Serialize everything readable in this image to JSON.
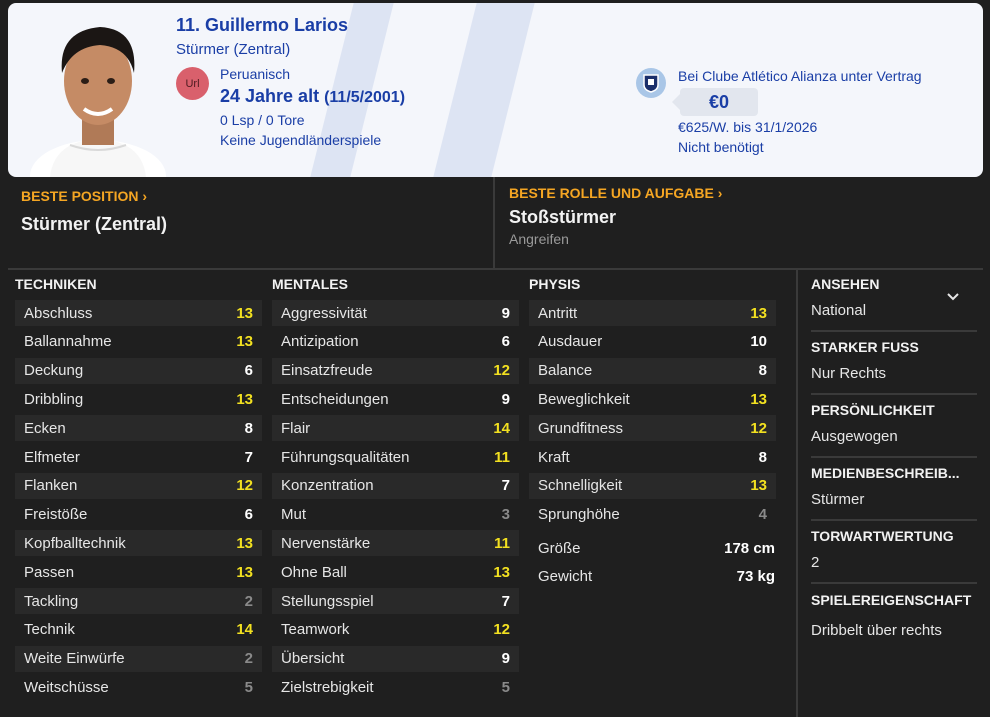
{
  "header": {
    "name": "11. Guillermo Larios",
    "position": "Stürmer (Zentral)",
    "nationality_badge": "Url",
    "nationality": "Peruanisch",
    "age": "24 Jahre alt",
    "dob": "(11/5/2001)",
    "caps": "0 Lsp / 0 Tore",
    "youth": "Keine Jugendländerspiele",
    "club_contract": "Bei Clube Atlético Alianza unter Vertrag",
    "value": "€0",
    "wage": "€625/W. bis 31/1/2026",
    "release": "Nicht benötigt"
  },
  "best_position": {
    "title": "BESTE POSITION",
    "value": "Stürmer (Zentral)"
  },
  "best_role": {
    "title": "BESTE ROLLE UND AUFGABE",
    "value": "Stoßstürmer",
    "duty": "Angreifen"
  },
  "columns": {
    "technical": {
      "title": "TECHNIKEN",
      "attrs": [
        {
          "label": "Abschluss",
          "value": "13",
          "tier": "y"
        },
        {
          "label": "Ballannahme",
          "value": "13",
          "tier": "y"
        },
        {
          "label": "Deckung",
          "value": "6",
          "tier": "w"
        },
        {
          "label": "Dribbling",
          "value": "13",
          "tier": "y"
        },
        {
          "label": "Ecken",
          "value": "8",
          "tier": "w"
        },
        {
          "label": "Elfmeter",
          "value": "7",
          "tier": "w"
        },
        {
          "label": "Flanken",
          "value": "12",
          "tier": "y"
        },
        {
          "label": "Freistöße",
          "value": "6",
          "tier": "w"
        },
        {
          "label": "Kopfballtechnik",
          "value": "13",
          "tier": "y"
        },
        {
          "label": "Passen",
          "value": "13",
          "tier": "y"
        },
        {
          "label": "Tackling",
          "value": "2",
          "tier": "g"
        },
        {
          "label": "Technik",
          "value": "14",
          "tier": "y"
        },
        {
          "label": "Weite Einwürfe",
          "value": "2",
          "tier": "g"
        },
        {
          "label": "Weitschüsse",
          "value": "5",
          "tier": "g"
        }
      ]
    },
    "mental": {
      "title": "MENTALES",
      "attrs": [
        {
          "label": "Aggressivität",
          "value": "9",
          "tier": "w"
        },
        {
          "label": "Antizipation",
          "value": "6",
          "tier": "w"
        },
        {
          "label": "Einsatzfreude",
          "value": "12",
          "tier": "y"
        },
        {
          "label": "Entscheidungen",
          "value": "9",
          "tier": "w"
        },
        {
          "label": "Flair",
          "value": "14",
          "tier": "y"
        },
        {
          "label": "Führungsqualitäten",
          "value": "11",
          "tier": "y"
        },
        {
          "label": "Konzentration",
          "value": "7",
          "tier": "w"
        },
        {
          "label": "Mut",
          "value": "3",
          "tier": "g"
        },
        {
          "label": "Nervenstärke",
          "value": "11",
          "tier": "y"
        },
        {
          "label": "Ohne Ball",
          "value": "13",
          "tier": "y"
        },
        {
          "label": "Stellungsspiel",
          "value": "7",
          "tier": "w"
        },
        {
          "label": "Teamwork",
          "value": "12",
          "tier": "y"
        },
        {
          "label": "Übersicht",
          "value": "9",
          "tier": "w"
        },
        {
          "label": "Zielstrebigkeit",
          "value": "5",
          "tier": "g"
        }
      ]
    },
    "physical": {
      "title": "PHYSIS",
      "attrs": [
        {
          "label": "Antritt",
          "value": "13",
          "tier": "y"
        },
        {
          "label": "Ausdauer",
          "value": "10",
          "tier": "w"
        },
        {
          "label": "Balance",
          "value": "8",
          "tier": "w"
        },
        {
          "label": "Beweglichkeit",
          "value": "13",
          "tier": "y"
        },
        {
          "label": "Grundfitness",
          "value": "12",
          "tier": "y"
        },
        {
          "label": "Kraft",
          "value": "8",
          "tier": "w"
        },
        {
          "label": "Schnelligkeit",
          "value": "13",
          "tier": "y"
        },
        {
          "label": "Sprunghöhe",
          "value": "4",
          "tier": "g"
        }
      ],
      "height_label": "Größe",
      "height_value": "178 cm",
      "weight_label": "Gewicht",
      "weight_value": "73 kg"
    }
  },
  "side": {
    "reputation_title": "ANSEHEN",
    "reputation": "National",
    "foot_title": "STARKER FUSS",
    "foot": "Nur Rechts",
    "personality_title": "PERSÖNLICHKEIT",
    "personality": "Ausgewogen",
    "media_title": "MEDIENBESCHREIB...",
    "media": "Stürmer",
    "gk_title": "TORWARTWERTUNG",
    "gk": "2",
    "traits_title": "SPIELEREIGENSCHAFT",
    "traits": "Dribbelt über rechts"
  },
  "colors": {
    "accent": "#f5a623",
    "high": "#f2e020",
    "header_text": "#1a3ea6"
  },
  "icons": {
    "reputation_toggle": "chevron-down-icon",
    "club": "club-crest-icon",
    "avatar": "player-portrait"
  }
}
